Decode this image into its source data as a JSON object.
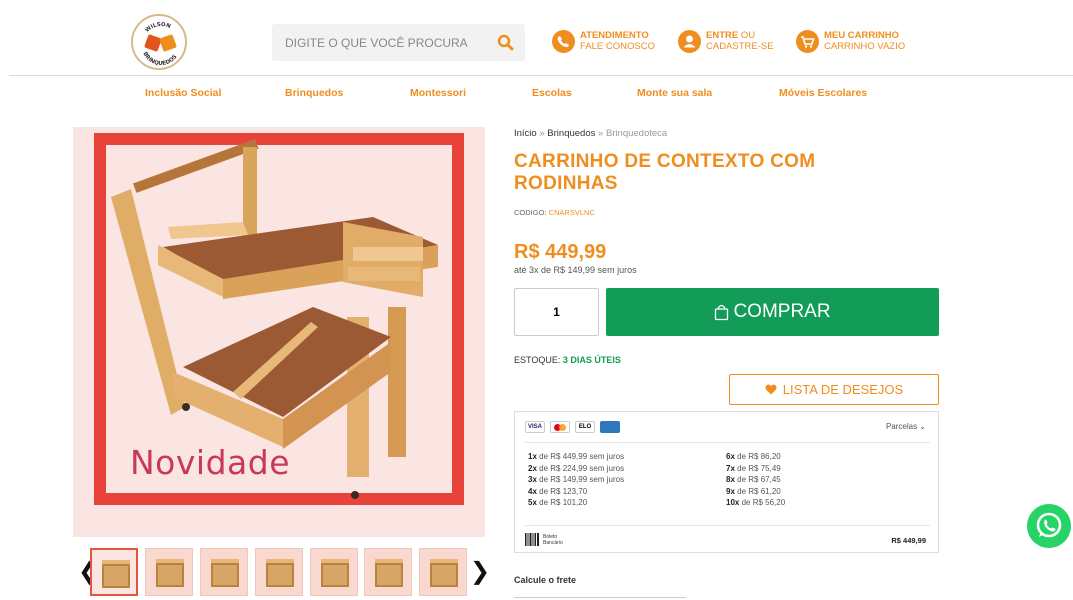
{
  "header": {
    "logo_text": "WILSON BRINQUEDOS",
    "search": {
      "placeholder": "DIGITE O QUE VOCÊ PROCURA",
      "value": "",
      "icon": "search-icon"
    },
    "service": {
      "line1": "ATENDIMENTO",
      "line2": "FALE CONOSCO",
      "icon": "phone-icon"
    },
    "account": {
      "line1_strong": "ENTRE",
      "line1_rest": " OU",
      "line2": "CADASTRE-SE",
      "icon": "user-icon"
    },
    "cart": {
      "line1": "MEU CARRINHO",
      "line2": "CARRINHO VAZIO",
      "icon": "cart-icon"
    }
  },
  "nav": [
    "Inclusão Social",
    "Brinquedos",
    "Montessori",
    "Escolas",
    "Monte sua sala",
    "Móveis Escolares"
  ],
  "gallery": {
    "badge_text": "Novidade",
    "thumbnail_count": 7,
    "selected_index": 0,
    "prev_label": "‹",
    "next_label": "›"
  },
  "breadcrumb": {
    "home": "Início",
    "sep": "»",
    "category": "Brinquedos",
    "current": "Brinquedoteca"
  },
  "product": {
    "title": "CARRINHO DE CONTEXTO COM RODINHAS",
    "code_label": "CODIGO: ",
    "code_value": "CNARSVLNC",
    "price": "R$ 449,99",
    "installments": "até 3x de R$ 149,99 sem juros",
    "quantity": "1",
    "buy_label": "COMPRAR",
    "stock_label": "ESTOQUE: ",
    "stock_value": "3 DIAS ÚTEIS",
    "wishlist_label": "LISTA DE DESEJOS"
  },
  "payment": {
    "cards": [
      "VISA",
      "Mastercard",
      "ELO",
      "Amex"
    ],
    "card_labels": {
      "visa": "VISA",
      "elo": "ELO"
    },
    "parcelas_label": "Parcelas",
    "left_col": [
      {
        "n": "1x",
        "text": " de R$ 449,99 sem juros"
      },
      {
        "n": "2x",
        "text": " de R$ 224,99 sem juros"
      },
      {
        "n": "3x",
        "text": " de R$ 149,99 sem juros"
      },
      {
        "n": "4x",
        "text": " de R$ 123,70"
      },
      {
        "n": "5x",
        "text": " de R$ 101,20"
      }
    ],
    "right_col": [
      {
        "n": "6x",
        "text": " de R$ 86,20"
      },
      {
        "n": "7x",
        "text": " de R$ 75,49"
      },
      {
        "n": "8x",
        "text": " de R$ 67,45"
      },
      {
        "n": "9x",
        "text": " de R$ 61,20"
      },
      {
        "n": "10x",
        "text": " de R$ 56,20"
      }
    ],
    "boleto_label_1": "Boleto",
    "boleto_label_2": "Bancário",
    "boleto_price": "R$ 449,99"
  },
  "shipping": {
    "label": "Calcule o frete"
  },
  "colors": {
    "brand_orange": "#f08d1f",
    "buy_green": "#129c57",
    "whatsapp_green": "#25d366"
  }
}
